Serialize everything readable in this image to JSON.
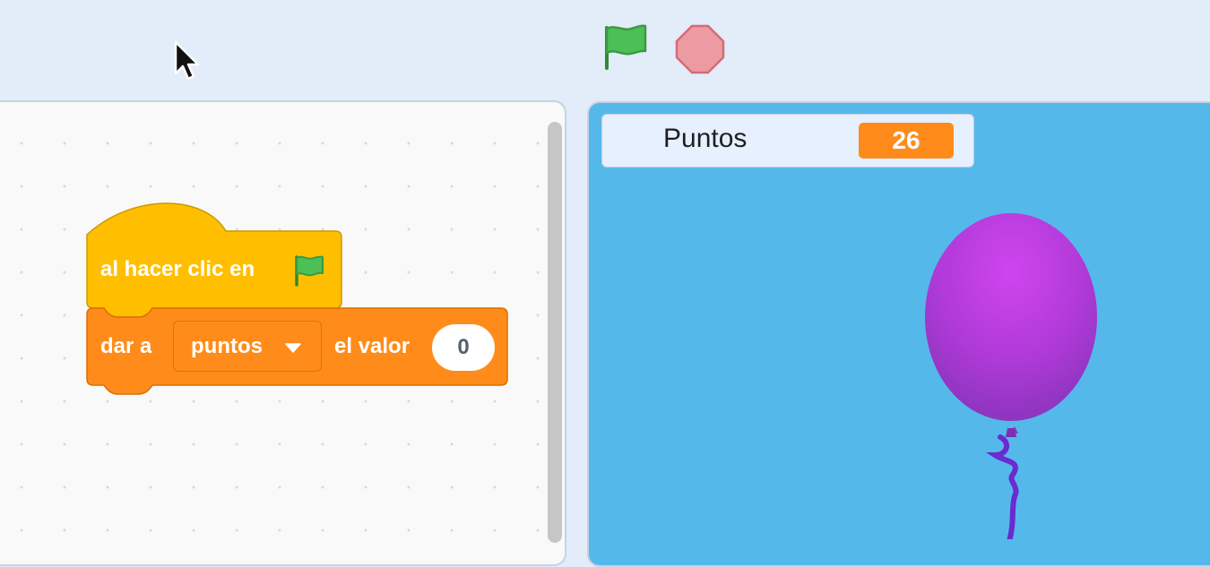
{
  "toolbar": {
    "green_flag_icon": "green-flag-icon",
    "stop_icon": "stop-octagon-icon"
  },
  "code_area": {
    "hat_block": {
      "label": "al hacer clic en",
      "icon": "green-flag-icon"
    },
    "set_block": {
      "label_before": "dar a",
      "variable": "puntos",
      "label_after": "el valor",
      "value": "0"
    }
  },
  "stage": {
    "monitor": {
      "label": "Puntos",
      "value": "26"
    },
    "sprite": "balloon"
  },
  "colors": {
    "events": "#ffbf00",
    "variables": "#ff8c1a",
    "stage_background": "#55b8ea",
    "balloon": "#b93be6"
  }
}
